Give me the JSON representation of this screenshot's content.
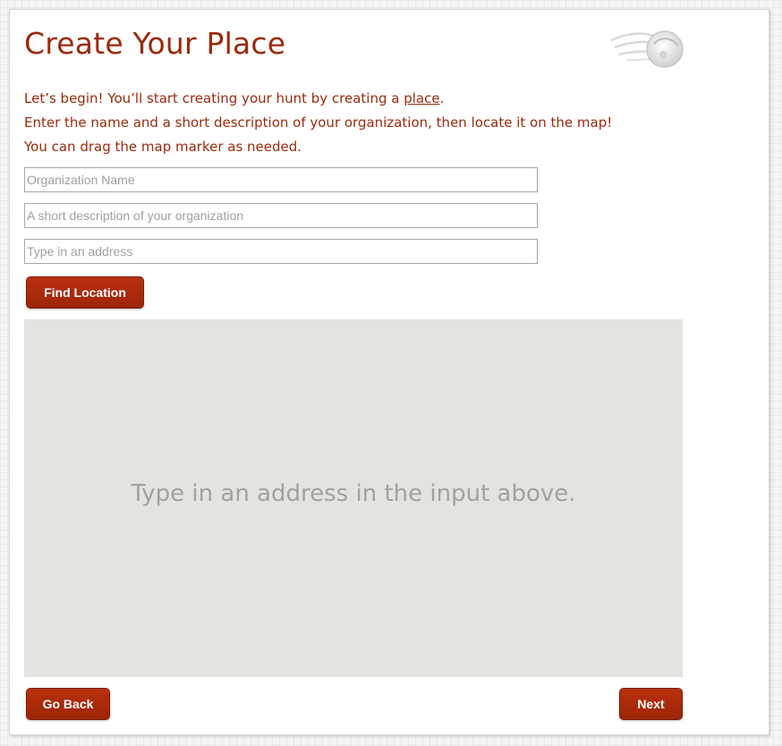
{
  "header": {
    "title": "Create Your Place",
    "logo_icon": "flame-orb-logo"
  },
  "intro": {
    "line1_prefix": "Let’s begin! You’ll start creating your hunt by creating a ",
    "line1_link": "place",
    "line1_suffix": ".",
    "line2": "Enter the name and a short description of your organization, then locate it on the map!",
    "line3": "You can drag the map marker as needed."
  },
  "form": {
    "org_name": {
      "value": "",
      "placeholder": "Organization Name"
    },
    "description": {
      "value": "",
      "placeholder": "A short description of your organization"
    },
    "address": {
      "value": "",
      "placeholder": "Type in an address"
    },
    "find_label": "Find Location"
  },
  "map": {
    "message": "Type in an address in the input above."
  },
  "footer": {
    "back_label": "Go Back",
    "next_label": "Next"
  },
  "colors": {
    "accent": "#9b2a0c",
    "button": "#a82a09",
    "map_bg": "#e5e3df"
  }
}
